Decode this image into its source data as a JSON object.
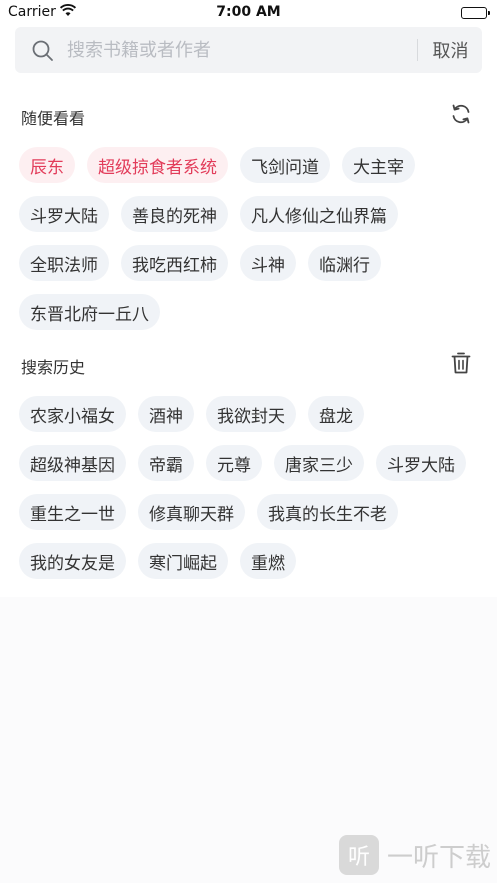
{
  "status_bar": {
    "carrier": "Carrier",
    "time": "7:00 AM"
  },
  "search": {
    "placeholder": "搜索书籍或者作者",
    "cancel_label": "取消"
  },
  "random": {
    "title": "随便看看",
    "refresh_icon": "refresh-icon",
    "rows": [
      [
        "辰东",
        "超级掠食者系统",
        "飞剑问道",
        "大主宰"
      ],
      [
        "斗罗大陆",
        "善良的死神",
        "凡人修仙之仙界篇"
      ],
      [
        "全职法师",
        "我吃西红柿",
        "斗神",
        "临渊行"
      ],
      [
        "东晋北府一丘八"
      ]
    ],
    "hot_color": "#e23c5a"
  },
  "history": {
    "title": "搜索历史",
    "delete_icon": "trash-icon",
    "rows": [
      [
        "农家小福女",
        "酒神",
        "我欲封天",
        "盘龙"
      ],
      [
        "超级神基因",
        "帝霸",
        "元尊",
        "唐家三少",
        "斗罗大陆"
      ],
      [
        "重生之一世",
        "修真聊天群",
        "我真的长生不老"
      ],
      [
        "我的女友是",
        "寒门崛起",
        "重燃"
      ]
    ]
  },
  "watermark": {
    "logo_char": "听",
    "text": "一听下载"
  }
}
